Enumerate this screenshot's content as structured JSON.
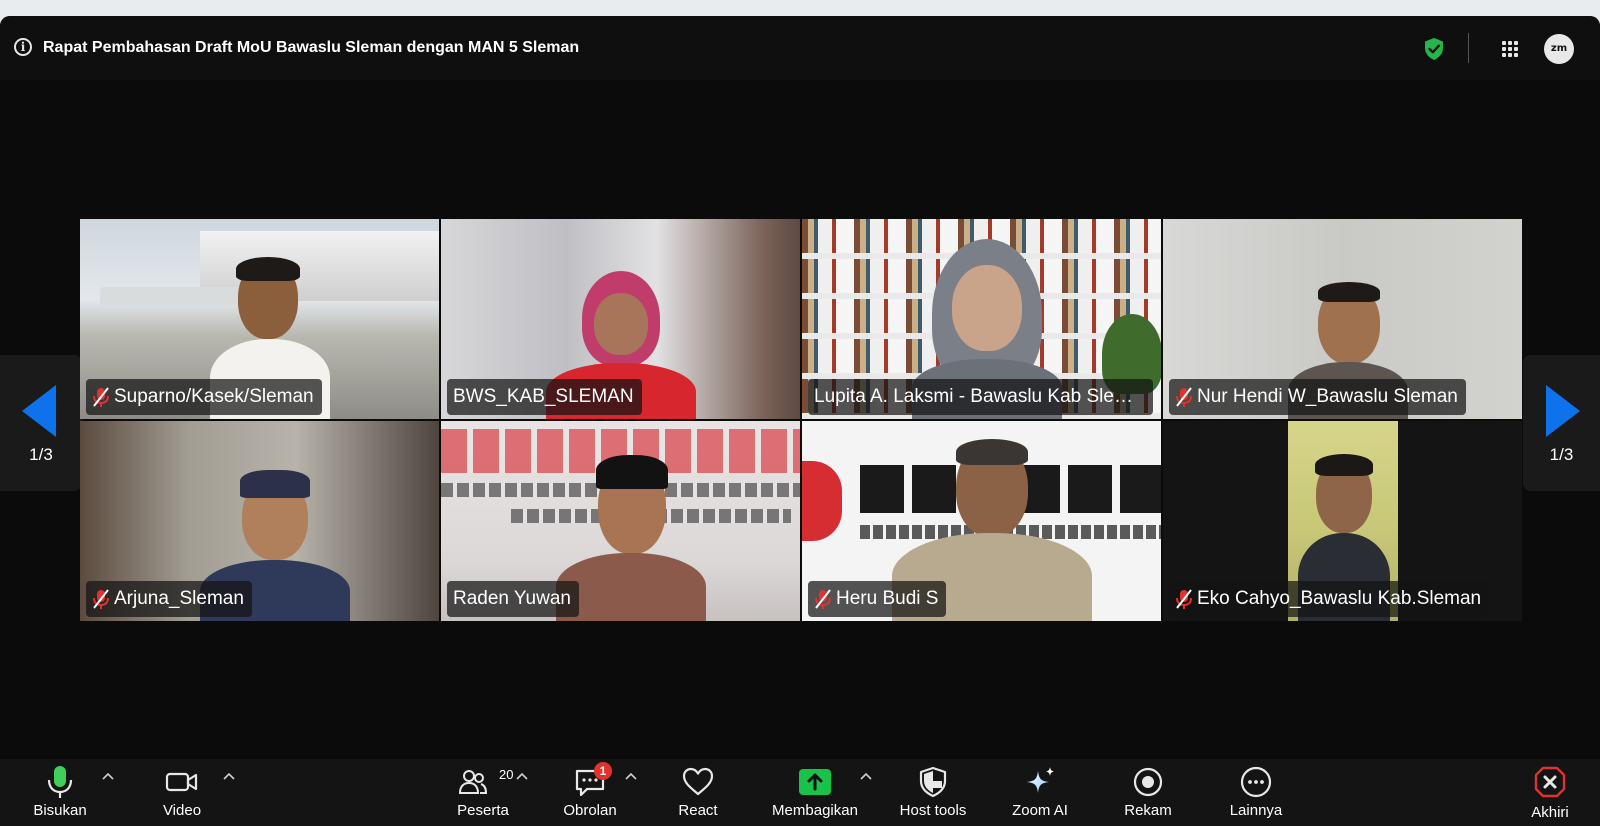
{
  "meeting": {
    "title": "Rapat Pembahasan Draft MoU Bawaslu Sleman dengan MAN 5 Sleman",
    "icons": [
      "info-icon",
      "shield-check-icon",
      "grid-icon",
      "zoom-logo"
    ],
    "logo_text": "zm"
  },
  "navigation": {
    "left_page": "1/3",
    "right_page": "1/3"
  },
  "participants": [
    {
      "name": "Suparno/Kasek/Sleman",
      "muted": true
    },
    {
      "name": "BWS_KAB_SLEMAN",
      "muted": false
    },
    {
      "name": "Lupita A. Laksmi - Bawaslu Kab Slem...",
      "muted": false
    },
    {
      "name": "Nur Hendi W_Bawaslu Sleman",
      "muted": true
    },
    {
      "name": "Arjuna_Sleman",
      "muted": true
    },
    {
      "name": "Raden Yuwan",
      "muted": false,
      "active_speaker": true
    },
    {
      "name": "Heru Budi S",
      "muted": true
    },
    {
      "name": "Eko Cahyo_Bawaslu Kab.Sleman",
      "muted": true
    }
  ],
  "toolbar": {
    "mic": "Bisukan",
    "video": "Video",
    "participants": "Peserta",
    "participants_count": "20",
    "chat": "Obrolan",
    "chat_badge": "1",
    "react": "React",
    "share": "Membagikan",
    "host_tools": "Host tools",
    "zoom_ai": "Zoom AI",
    "record": "Rekam",
    "more": "Lainnya",
    "end": "Akhiri"
  },
  "colors": {
    "accent_blue": "#0e72ed",
    "mic_green": "#3fcf5a",
    "share_green": "#19c24b",
    "shield_green": "#26b548",
    "end_red": "#e0322f"
  }
}
